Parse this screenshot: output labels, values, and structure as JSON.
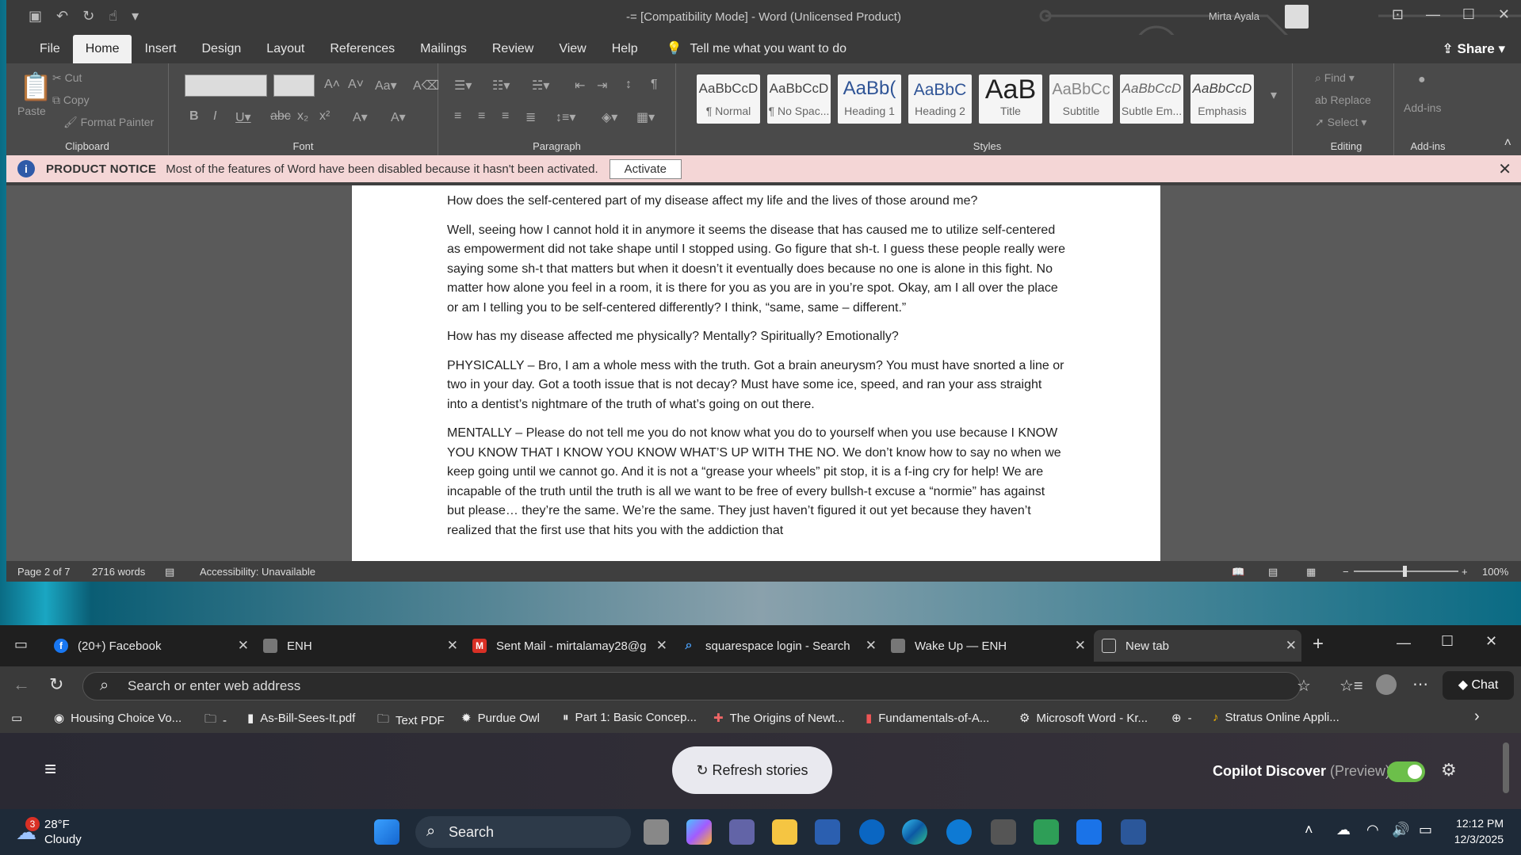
{
  "word": {
    "title": "-= [Compatibility Mode]  -  Word (Unlicensed Product)",
    "user": "Mirta Ayala",
    "share": "Share",
    "menu": [
      "File",
      "Home",
      "Insert",
      "Design",
      "Layout",
      "References",
      "Mailings",
      "Review",
      "View",
      "Help"
    ],
    "tell_me": "Tell me what you want to do",
    "clipboard": {
      "paste": "Paste",
      "cut": "Cut",
      "copy": "Copy",
      "format_painter": "Format Painter",
      "label": "Clipboard"
    },
    "font_label": "Font",
    "paragraph_label": "Paragraph",
    "styles_label": "Styles",
    "styles": [
      {
        "preview": "AaBbCcD",
        "name": "¶ Normal"
      },
      {
        "preview": "AaBbCcD",
        "name": "¶ No Spac..."
      },
      {
        "preview": "AaBb(",
        "name": "Heading 1"
      },
      {
        "preview": "AaBbC",
        "name": "Heading 2"
      },
      {
        "preview": "AaB",
        "name": "Title"
      },
      {
        "preview": "AaBbCc",
        "name": "Subtitle"
      },
      {
        "preview": "AaBbCcD",
        "name": "Subtle Em..."
      },
      {
        "preview": "AaBbCcD",
        "name": "Emphasis"
      }
    ],
    "editing": {
      "find": "Find",
      "replace": "Replace",
      "select": "Select",
      "label": "Editing"
    },
    "addins": {
      "button": "Add-ins",
      "label": "Add-ins"
    },
    "notice": {
      "title": "PRODUCT NOTICE",
      "message": "Most of the features of Word have been disabled because it hasn't been activated.",
      "activate": "Activate"
    },
    "document": [
      "How does the self-centered part of my disease affect my life and the lives of those around me?",
      "Well, seeing how I cannot hold it in anymore it seems the disease that has caused me to utilize self-centered as empowerment did not take shape until I stopped using. Go figure that sh-t. I guess these people really were saying some sh-t that matters but when it doesn’t it eventually does because no one is alone in this fight. No matter how alone you feel in a room, it is there for you as you are in you’re spot. Okay, am I all over the place or am I telling you to be self-centered differently? I think, “same, same – different.”",
      "How has my disease affected me physically? Mentally? Spiritually? Emotionally?",
      "PHYSICALLY – Bro, I am a whole mess with the truth. Got a brain aneurysm? You must have snorted a line or two in your day. Got a tooth issue that is not decay? Must have some ice, speed, and ran your ass straight into a dentist’s nightmare of the truth of what’s going on out there.",
      "MENTALLY – Please do not tell me you do not know what you do to yourself when you use because I KNOW YOU KNOW THAT I KNOW YOU KNOW WHAT’S UP WITH THE NO. We don’t know how to say no when we keep going until we cannot go. And it is not a “grease your wheels” pit stop, it is a f-ing cry for help! We are incapable of the truth until the truth is all we want to be free of every bullsh-t excuse a “normie” has against but please… they’re the same. We’re the same. They just haven’t figured it out yet because they haven’t realized that the first use that hits you with the addiction that"
    ],
    "status": {
      "page": "Page 2 of 7",
      "words": "2716 words",
      "accessibility": "Accessibility: Unavailable",
      "zoom": "100%"
    }
  },
  "browser": {
    "tabs": [
      {
        "label": "(20+) Facebook"
      },
      {
        "label": "ENH"
      },
      {
        "label": "Sent Mail - mirtalamay28@g"
      },
      {
        "label": "squarespace login - Search"
      },
      {
        "label": "Wake Up — ENH"
      },
      {
        "label": "New tab"
      }
    ],
    "address_placeholder": "Search or enter web address",
    "chat": "Chat",
    "bookmarks": [
      "Housing Choice Vo...",
      "-",
      "As-Bill-Sees-It.pdf",
      "Text PDF",
      "Purdue Owl",
      "Part 1: Basic Concep...",
      "The Origins of Newt...",
      "Fundamentals-of-A...",
      "Microsoft Word - Kr...",
      "-",
      "Stratus Online Appli..."
    ],
    "refresh": "Refresh stories",
    "discover": "Copilot Discover",
    "preview": "(Preview)"
  },
  "taskbar": {
    "badge": "3",
    "temp": "28°F",
    "condition": "Cloudy",
    "search": "Search",
    "time": "12:12 PM",
    "date": "12/3/2025"
  },
  "colors": {
    "accent_word": "#2b579a",
    "toggle_on": "#6cbf4a",
    "notice_bg": "#f4d6d6"
  }
}
